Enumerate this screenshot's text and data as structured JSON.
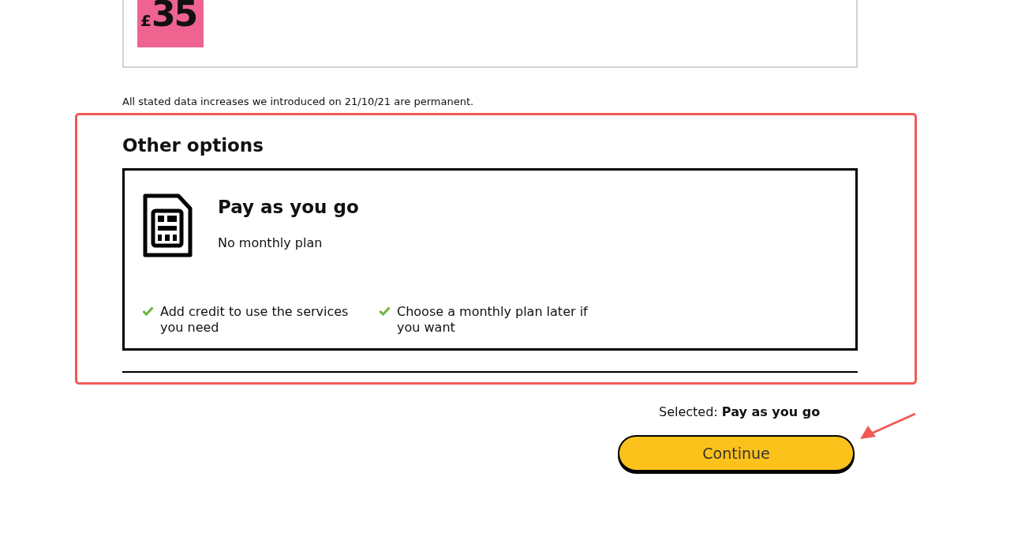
{
  "plan_card": {
    "price": {
      "currency": "£",
      "amount": "35"
    }
  },
  "note": "All stated data increases we introduced on 21/10/21 are permanent.",
  "other_options": {
    "heading": "Other options",
    "options": [
      {
        "title": "Pay as you go",
        "subtitle": "No monthly plan",
        "selected": true,
        "features": [
          "Add credit to use the services you need",
          "Choose a monthly plan later if you want"
        ]
      }
    ]
  },
  "selection_summary": "Selected: **Pay as you go**",
  "continue_button": "Continue"
}
